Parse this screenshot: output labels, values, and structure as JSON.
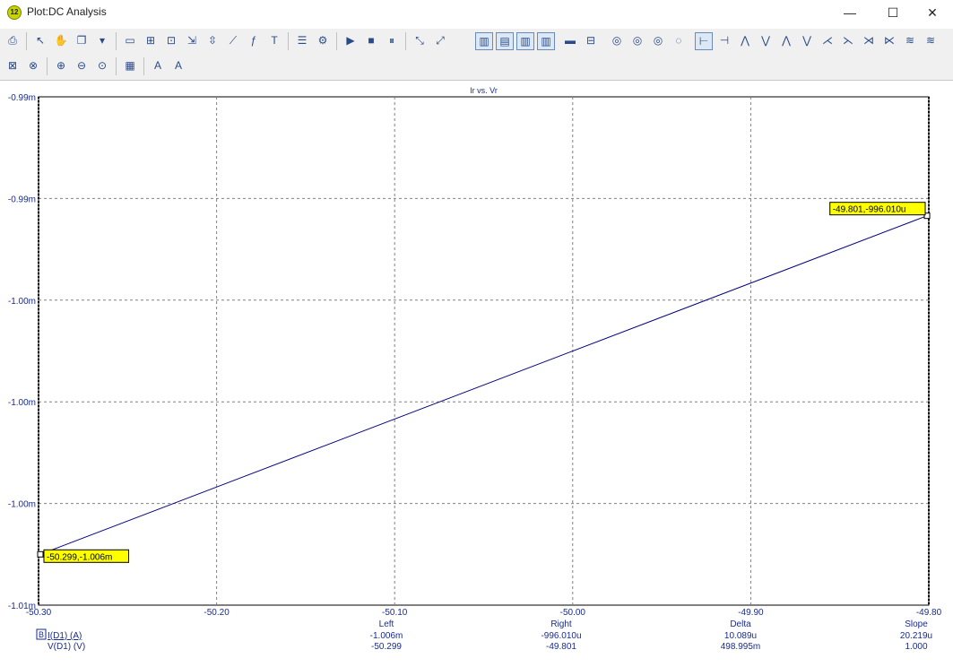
{
  "window": {
    "title": "Plot:DC Analysis",
    "app_badge": "12",
    "minimize": "—",
    "maximize": "☐",
    "close": "✕"
  },
  "toolbar_row1": [
    {
      "name": "print-icon",
      "glyph": "⎙"
    },
    {
      "name": "pointer-icon",
      "glyph": "↖"
    },
    {
      "name": "hand-icon",
      "glyph": "✋"
    },
    {
      "name": "copy-icon",
      "glyph": "❐"
    },
    {
      "name": "dropdown-icon",
      "glyph": "▾"
    },
    {
      "name": "window-icon",
      "glyph": "▭"
    },
    {
      "name": "zoom-window-icon",
      "glyph": "⊞"
    },
    {
      "name": "zoom-fit-icon",
      "glyph": "⊡"
    },
    {
      "name": "zoom-x-icon",
      "glyph": "⇲"
    },
    {
      "name": "zoom-y-icon",
      "glyph": "⇳"
    },
    {
      "name": "graph-icon",
      "glyph": "⟋"
    },
    {
      "name": "function-icon",
      "glyph": "ƒ"
    },
    {
      "name": "text-icon",
      "glyph": "T"
    },
    {
      "name": "properties-icon",
      "glyph": "☰"
    },
    {
      "name": "settings-icon",
      "glyph": "⚙"
    },
    {
      "name": "run-icon",
      "glyph": "▶"
    },
    {
      "name": "stop-icon",
      "glyph": "■"
    },
    {
      "name": "pause-icon",
      "glyph": "⏸"
    },
    {
      "name": "cursor-a-icon",
      "glyph": "⤡"
    },
    {
      "name": "cursor-b-icon",
      "glyph": "⤢"
    }
  ],
  "toolbar_row2": [
    {
      "name": "fit-icon",
      "glyph": "⊠"
    },
    {
      "name": "fit-all-icon",
      "glyph": "⊗"
    },
    {
      "name": "zoom-in-icon",
      "glyph": "⊕"
    },
    {
      "name": "zoom-out-icon",
      "glyph": "⊖"
    },
    {
      "name": "zoom-100-icon",
      "glyph": "⊙"
    },
    {
      "name": "grid-icon",
      "glyph": "▦"
    },
    {
      "name": "font-icon",
      "glyph": "A"
    },
    {
      "name": "font-color-icon",
      "glyph": "A"
    }
  ],
  "chart_data": {
    "type": "line",
    "title": "Ir vs. Vr",
    "xlim": [
      -50.3,
      -49.8
    ],
    "ylim": [
      -1.0075,
      -0.9925
    ],
    "x_ticks": [
      "-50.30",
      "-50.20",
      "-50.10",
      "-50.00",
      "-49.90",
      "-49.80"
    ],
    "y_ticks": [
      "-0.99m",
      "-0.99m",
      "-1.00m",
      "-1.00m",
      "-1.00m",
      "-1.01m"
    ],
    "series": [
      {
        "color": "#00007f",
        "x": [
          -50.299,
          -49.801
        ],
        "y": [
          -1.006,
          -0.99601
        ]
      }
    ],
    "cursors": [
      {
        "label": "-50.299,-1.006m",
        "x": -50.299,
        "y": -1.006
      },
      {
        "label": "-49.801,-996.010u",
        "x": -49.801,
        "y": -0.99601
      }
    ],
    "grid": true
  },
  "readout": {
    "headers": [
      "Left",
      "Right",
      "Delta",
      "Slope"
    ],
    "badge": "B",
    "rows": [
      {
        "label": "I(D1) (A)",
        "values": [
          "-1.006m",
          "-996.010u",
          "10.089u",
          "20.219u"
        ]
      },
      {
        "label": "V(D1) (V)",
        "values": [
          "-50.299",
          "-49.801",
          "498.995m",
          "1.000"
        ]
      }
    ]
  },
  "colors": {
    "axis_text": "#1a2b8f",
    "trace": "#00007f",
    "cursor_label_bg": "#ffff00",
    "grid": "#808080"
  }
}
